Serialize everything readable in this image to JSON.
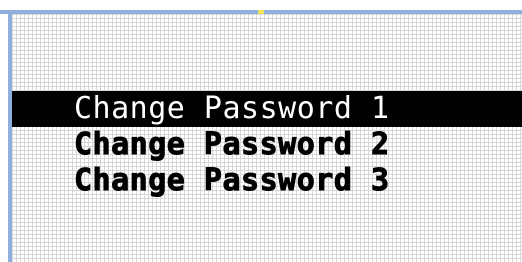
{
  "menu": {
    "items": [
      {
        "label": "Change Password 1",
        "selected": true
      },
      {
        "label": "Change Password 2",
        "selected": false
      },
      {
        "label": "Change Password 3",
        "selected": false
      }
    ]
  },
  "colors": {
    "frame_border": "#8fb0dd",
    "marker": "#f3e35b",
    "grid": "#d6d6d6",
    "highlight_bg": "#000000",
    "highlight_text": "#ffffff",
    "text": "#000000"
  }
}
